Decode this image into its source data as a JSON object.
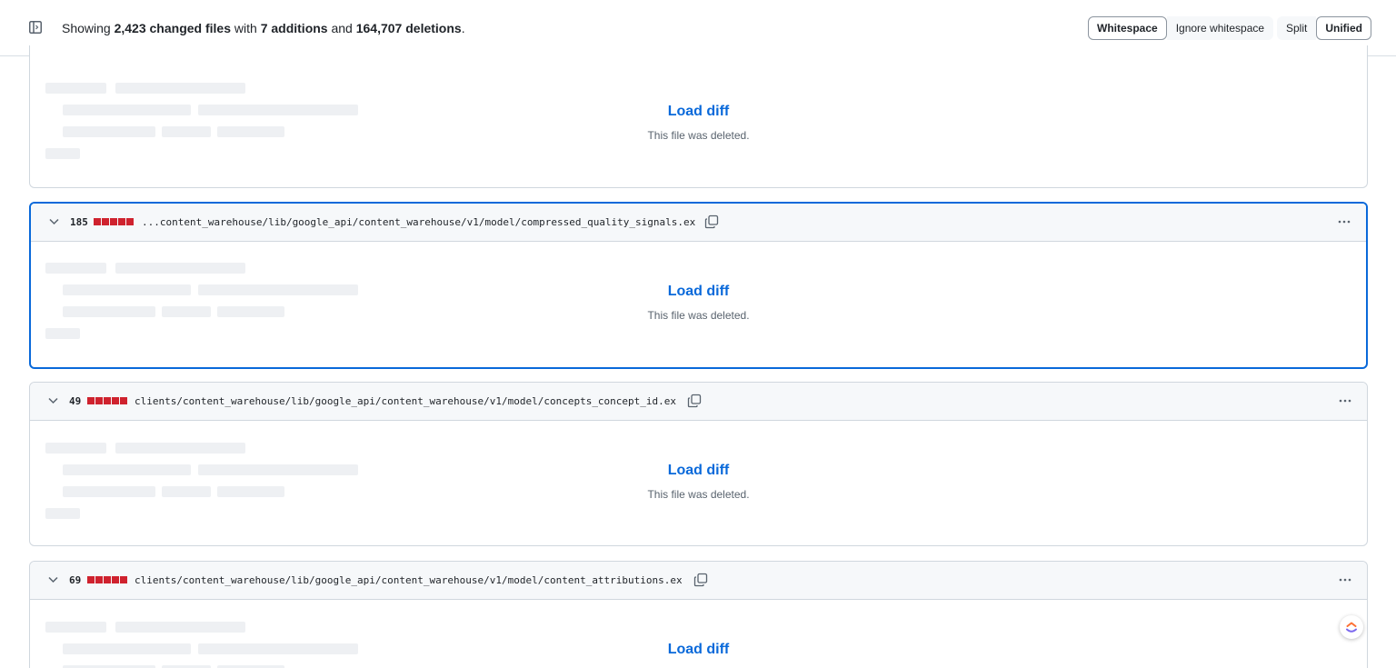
{
  "summary": {
    "prefix": "Showing",
    "files": "2,423 changed files",
    "mid1": "with",
    "additions": "7 additions",
    "mid2": "and",
    "deletions": "164,707 deletions",
    "suffix": "."
  },
  "whitespace_options": [
    "Whitespace",
    "Ignore whitespace"
  ],
  "whitespace_selected": "Whitespace",
  "view_options": [
    "Split",
    "Unified"
  ],
  "view_selected": "Unified",
  "files": [
    {
      "count": "",
      "path": "",
      "load_label": "Load diff",
      "note": "This file was deleted."
    },
    {
      "count": "185",
      "path": "...content_warehouse/lib/google_api/content_warehouse/v1/model/compressed_quality_signals.ex",
      "load_label": "Load diff",
      "note": "This file was deleted."
    },
    {
      "count": "49",
      "path": "clients/content_warehouse/lib/google_api/content_warehouse/v1/model/concepts_concept_id.ex",
      "load_label": "Load diff",
      "note": "This file was deleted."
    },
    {
      "count": "69",
      "path": "clients/content_warehouse/lib/google_api/content_warehouse/v1/model/content_attributions.ex",
      "load_label": "Load diff",
      "note": ""
    }
  ],
  "colors": {
    "accent": "#0969da",
    "deletion": "#cf222e",
    "border": "#d0d7de",
    "header_bg": "#f6f8fa"
  },
  "icons": {
    "sidebar_toggle": "sidebar-expand-icon",
    "chevron": "chevron-down-icon",
    "copy": "copy-icon",
    "more": "kebab-horizontal-icon",
    "floating": "clickup-icon"
  }
}
